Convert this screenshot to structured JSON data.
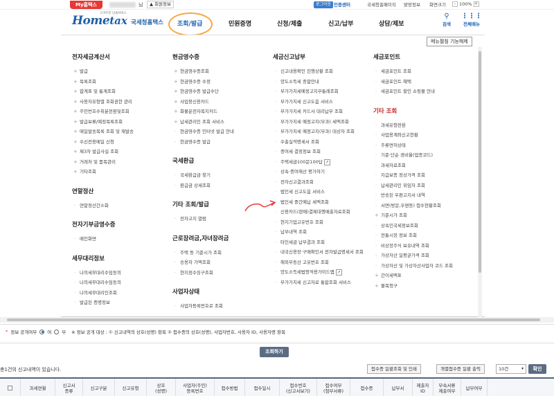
{
  "topbar": {
    "myhome": "My홈택스",
    "nim": "님",
    "member_info": "회원정보",
    "logout": "로그아웃",
    "chat": "인증센터",
    "util_items": [
      "국세청홈페이지",
      "밝망정보",
      "화면크기"
    ],
    "zoom_minus": "-",
    "zoom_value": "100%",
    "zoom_plus": "+"
  },
  "header": {
    "logo_home": "Home",
    "logo_tax": "tax",
    "logo_slogan": "스마트한 납세서비스",
    "logo_kname": "국세청홈택스",
    "gnb": [
      "조회/발급",
      "민원증명",
      "신청/제출",
      "신고/납부",
      "상담/제보"
    ],
    "search_label": "검색",
    "menu_label": "전체메뉴"
  },
  "mega": {
    "release_button": "메뉴펼침 기능해제",
    "col1": {
      "sections": [
        {
          "title": "전자세금계산서",
          "items": [
            {
              "t": "발급",
              "plus": true
            },
            {
              "t": "목록조회",
              "plus": true
            },
            {
              "t": "합계표 및 통계조회",
              "plus": true
            },
            {
              "t": "사용자유형별 조회권한 관리",
              "plus": true
            },
            {
              "t": "주민번호수취분전환및조회",
              "plus": true
            },
            {
              "t": "발급보류/예정목록조회",
              "plus": true
            },
            {
              "t": "메일발송목록 조회 및 재발송",
              "plus": true
            },
            {
              "t": "수신전용메일 신청",
              "plus": true
            },
            {
              "t": "제3자 발급사실 조회",
              "plus": true
            },
            {
              "t": "거래처 및 품목관리",
              "plus": true
            },
            {
              "t": "기타조회",
              "plus": true
            }
          ]
        },
        {
          "title": "연말정산",
          "items": [
            {
              "t": "연말정산간소화",
              "plus": false
            }
          ]
        },
        {
          "title": "전자기부금영수증",
          "items": [
            {
              "t": "메인화면",
              "plus": false
            }
          ]
        },
        {
          "title": "세무대리정보",
          "items": [
            {
              "t": "나의세무대리수임동의",
              "plus": false
            },
            {
              "t": "나의세무대리수임동의",
              "plus": false
            },
            {
              "t": "나의세무대리인조회",
              "plus": false
            },
            {
              "t": "발급된 증명정보",
              "plus": false
            }
          ]
        }
      ]
    },
    "col2": {
      "sections": [
        {
          "title": "현금영수증",
          "items": [
            {
              "t": "현금영수증조회",
              "plus": true
            },
            {
              "t": "현금영수증 수정",
              "plus": true
            },
            {
              "t": "현금영수증 발급수단",
              "plus": true
            },
            {
              "t": "사업용신용카드",
              "plus": true
            },
            {
              "t": "화물운전자복지카드",
              "plus": true
            },
            {
              "t": "납세관리인 조회 서비스",
              "plus": true
            },
            {
              "t": "현금영수증 인터넷 발급 안내",
              "plus": false
            },
            {
              "t": "현금영수증 발급",
              "plus": false
            }
          ]
        },
        {
          "title": "국세환급",
          "items": [
            {
              "t": "국세환급금 찾기",
              "plus": false
            },
            {
              "t": "환급금 상세조회",
              "plus": false
            }
          ]
        },
        {
          "title": "기타 조회/발급",
          "items": [
            {
              "t": "전자고지 열람",
              "plus": false
            }
          ]
        },
        {
          "title": "근로장려금,자녀장려금",
          "items": [
            {
              "t": "주택 등 기준시가 조회",
              "plus": false
            },
            {
              "t": "승용차 가액조회",
              "plus": false
            },
            {
              "t": "현지정수징구조회",
              "plus": false
            }
          ]
        },
        {
          "title": "사업자상태",
          "items": [
            {
              "t": "사업자등록번호로 조회",
              "plus": false
            }
          ]
        }
      ]
    },
    "col3": {
      "sections": [
        {
          "title": "세금신고납부",
          "items": [
            {
              "t": "신고내용확인 진행상황 조회"
            },
            {
              "t": "양도소득세 종합안내"
            },
            {
              "t": "부가가치세예정고지부통례조회"
            },
            {
              "t": "부가가치세 신고도움 서비스"
            },
            {
              "t": "부가가치세 카드사 대리납부 조회"
            },
            {
              "t": "부가가치세 예정고지(부과) 세액조회"
            },
            {
              "t": "부가가치세 예정고지(부과) 대상자 조회"
            },
            {
              "t": "수출실적명세서 조회"
            },
            {
              "t": "증여세 결정정보 조회"
            },
            {
              "t": "주택세금100문100답",
              "ext": true
            },
            {
              "t": "상속·증여재산 평가하기"
            },
            {
              "t": "전자신고결과조회"
            },
            {
              "t": "법인세 신고도움 서비스"
            },
            {
              "t": "법인세 중간예납 세액조회"
            },
            {
              "t": "신용카드(판매)결제대행매출자료조회"
            },
            {
              "t": "현지기업고유번호 조회"
            },
            {
              "t": "납부내역 조회"
            },
            {
              "t": "타인세금 납부결과 조회"
            },
            {
              "t": "내국신용장·구매확인서 전자발급명세서 조회"
            },
            {
              "t": "해외부동산 고유번호 조회"
            },
            {
              "t": "양도소득세법령적용가이드맵",
              "ext": true
            },
            {
              "t": "부가가치세 신고자료 통합조회 서비스"
            }
          ]
        }
      ]
    },
    "col4": {
      "sections": [
        {
          "title": "세금포인트",
          "red": false,
          "items": [
            {
              "t": "세금포인트 조회",
              "plus": false
            },
            {
              "t": "세금포인트 혜택",
              "plus": false
            },
            {
              "t": "세금포인트 할인 쇼핑몰 안내",
              "plus": false
            }
          ]
        },
        {
          "title": "기타 조회",
          "red": true,
          "items": [
            {
              "t": "과세유형전환",
              "plus": false
            },
            {
              "t": "사업용계좌신고현황",
              "plus": false
            },
            {
              "t": "주류면허상태",
              "plus": false
            },
            {
              "t": "기준·단순 경비율(업종코드)",
              "plus": false
            },
            {
              "t": "과세자료조회",
              "plus": false
            },
            {
              "t": "지급보증 정상가격 조회",
              "plus": false
            },
            {
              "t": "납세관리인 위임자 조회",
              "plus": false
            },
            {
              "t": "반송된 우편고지서 내역",
              "plus": false
            },
            {
              "t": "서면(방문,우편등) 접수현황조회",
              "plus": false
            },
            {
              "t": "기준시가 조회",
              "plus": true
            },
            {
              "t": "상속인국세정보조회",
              "plus": false
            },
            {
              "t": "전통시장 정보 조회",
              "plus": false
            },
            {
              "t": "비상장주식 보유내역 조회",
              "plus": false
            },
            {
              "t": "가상자산 일평균가격 조회",
              "plus": false
            },
            {
              "t": "가상자산 및 가상자산사업자 코드 조회",
              "plus": false
            },
            {
              "t": "간이세액표",
              "plus": true
            },
            {
              "t": "불복청구",
              "plus": true
            }
          ]
        }
      ]
    }
  },
  "privacy": {
    "label": "정보 공개여부",
    "opt_yes": "여",
    "opt_no": "부",
    "note": "※ 정보 공개 대상 : ① 신고내역의 상호(성명) 항목 ② 접수증의 상호(성명), 사업자번호, 사용자 ID, 사용자명 항목"
  },
  "search_button": "조회하기",
  "result_count": "총1건의 신고내역이 있습니다.",
  "actions": {
    "print_btn": "접수증 일괄조회 및 인쇄",
    "print_btn2": "개별접수증 일괄 출력",
    "page_size": "10건",
    "go": "확인"
  },
  "table": {
    "headers": [
      "과세연월",
      "신고서\n종류",
      "신고구분",
      "신고유형",
      "상호\n(성명)",
      "사업자(주민)\n등록번호",
      "접수방법",
      "접수일시",
      "접수번호\n(신고서보기)",
      "접수여부\n(첨부서류)",
      "접수증",
      "납부서",
      "제출자\nID",
      "부속서류\n제출여부",
      "납부여부"
    ]
  }
}
